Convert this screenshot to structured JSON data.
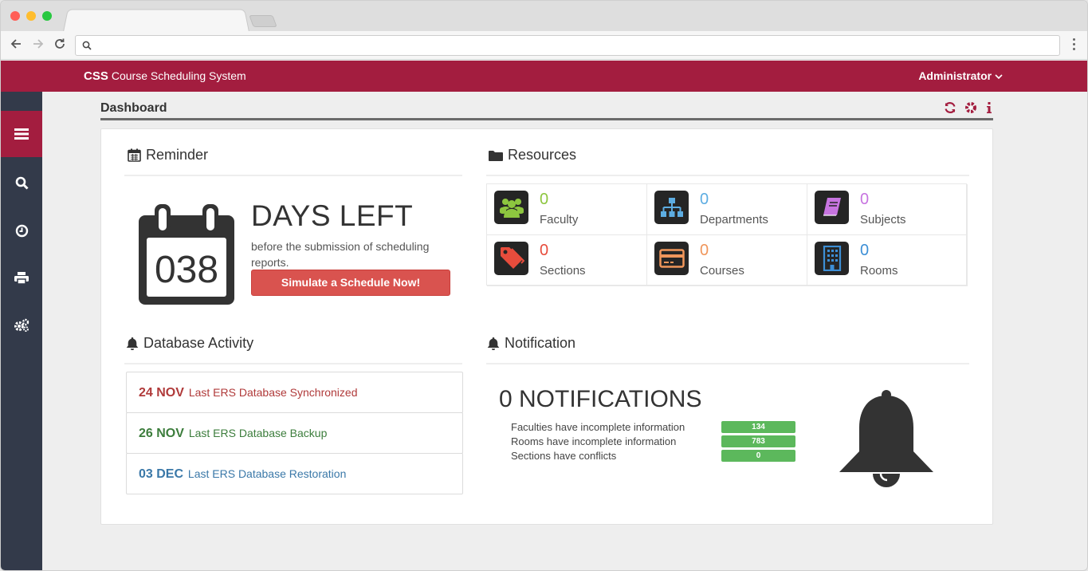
{
  "browser": {
    "address_value": "",
    "colors": {
      "close": "#ff5f57",
      "minimize": "#ffbd2e",
      "maximize": "#28c840"
    }
  },
  "header": {
    "brand_short": "CSS",
    "brand_full": "Course Scheduling System",
    "user": "Administrator",
    "accent": "#a31d3f"
  },
  "sidebar": {
    "items": [
      {
        "icon": "menu-icon"
      },
      {
        "icon": "search-icon"
      },
      {
        "icon": "clock-icon"
      },
      {
        "icon": "print-icon"
      },
      {
        "icon": "gears-icon"
      }
    ]
  },
  "page": {
    "title": "Dashboard",
    "actions": [
      "refresh-icon",
      "gear-icon",
      "info-icon"
    ]
  },
  "reminder": {
    "heading": "Reminder",
    "days": "038",
    "title": "DAYS LEFT",
    "subtitle": "before the submission of scheduling reports.",
    "button": "Simulate a Schedule Now!"
  },
  "resources": {
    "heading": "Resources",
    "items": [
      {
        "count": "0",
        "label": "Faculty",
        "color": "#8dc63f",
        "icon": "users-icon"
      },
      {
        "count": "0",
        "label": "Departments",
        "color": "#5dade2",
        "icon": "sitemap-icon"
      },
      {
        "count": "0",
        "label": "Subjects",
        "color": "#c774e0",
        "icon": "book-icon"
      },
      {
        "count": "0",
        "label": "Sections",
        "color": "#e74c3c",
        "icon": "tag-icon"
      },
      {
        "count": "0",
        "label": "Courses",
        "color": "#f0965b",
        "icon": "card-icon"
      },
      {
        "count": "0",
        "label": "Rooms",
        "color": "#3d8fd6",
        "icon": "building-icon"
      }
    ]
  },
  "activity": {
    "heading": "Database Activity",
    "items": [
      {
        "date": "24 NOV",
        "text": "Last ERS Database Synchronized",
        "color": "#b03a3a"
      },
      {
        "date": "26 NOV",
        "text": "Last ERS Database Backup",
        "color": "#3c7d3c"
      },
      {
        "date": "03 DEC",
        "text": "Last ERS Database Restoration",
        "color": "#3a78a8"
      }
    ]
  },
  "notification": {
    "heading": "Notification",
    "title": "0 NOTIFICATIONS",
    "rows": [
      {
        "text": "Faculties have incomplete information",
        "value": "134"
      },
      {
        "text": "Rooms have incomplete information",
        "value": "783"
      },
      {
        "text": "Sections have conflicts",
        "value": "0"
      }
    ]
  }
}
